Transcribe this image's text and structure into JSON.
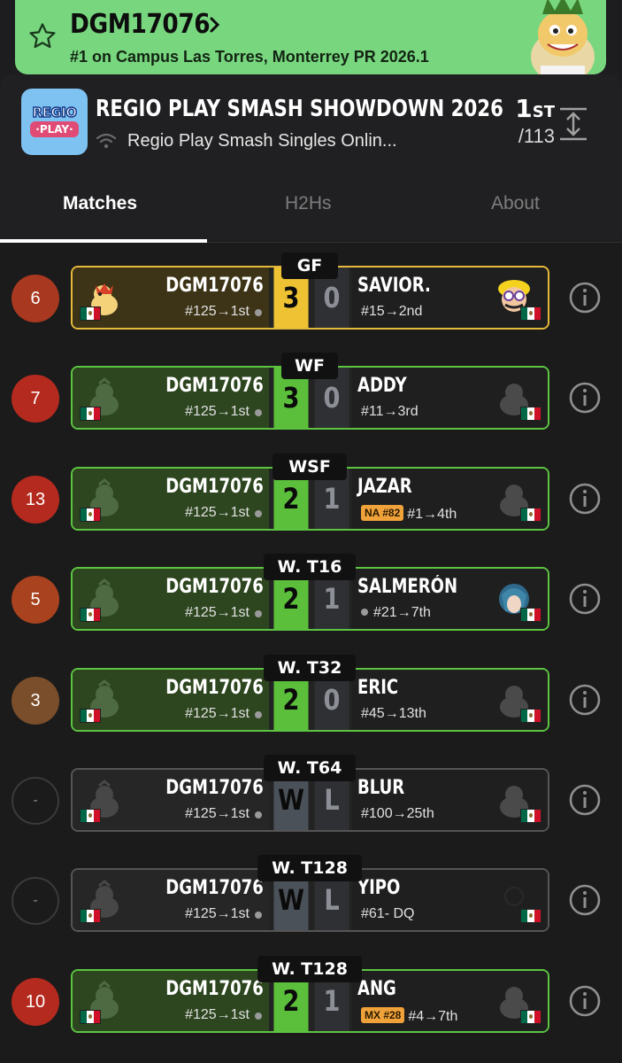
{
  "banner": {
    "player": "DGM17076",
    "subtitle": "#1 on Campus Las Torres, Monterrey PR 2026.1"
  },
  "tournament": {
    "logo_line1": "REGIO",
    "logo_line2": "·PLAY·",
    "title": "REGIO PLAY SMASH SHOWDOWN 2026",
    "event": "Regio Play Smash Singles Onlin...",
    "placement": "1",
    "placement_suffix": "ST",
    "entrants": "/113"
  },
  "tabs": [
    "Matches",
    "H2Hs",
    "About"
  ],
  "colors": {
    "banner_green": "#78d67f",
    "win_green": "#5bbf3b",
    "gold": "#eec232",
    "seed_red": "#b52a1e",
    "badge_orange": "#f0a23a"
  },
  "matches": [
    {
      "seed": "6",
      "round": "GF",
      "player": "DGM17076",
      "player_seed": "#125→1st",
      "score1": "3",
      "score2": "0",
      "opponent": "SAVIOR.",
      "badge": "",
      "opp_seed": "#15→2nd",
      "opp_dot": false,
      "style": "gold",
      "char_left": "bowser-icon",
      "char_right": "wario-icon"
    },
    {
      "seed": "7",
      "round": "WF",
      "player": "DGM17076",
      "player_seed": "#125→1st",
      "score1": "3",
      "score2": "0",
      "opponent": "ADDY",
      "badge": "",
      "opp_seed": "#11→3rd",
      "opp_dot": false,
      "style": "win",
      "char_left": "character-icon",
      "char_right": "character-icon"
    },
    {
      "seed": "13",
      "round": "WSF",
      "player": "DGM17076",
      "player_seed": "#125→1st",
      "score1": "2",
      "score2": "1",
      "opponent": "JAZAR",
      "badge": "NA #82",
      "opp_seed": "#1→4th",
      "opp_dot": false,
      "style": "win",
      "char_left": "character-icon",
      "char_right": "character-icon"
    },
    {
      "seed": "5",
      "round": "W. T16",
      "player": "DGM17076",
      "player_seed": "#125→1st",
      "score1": "2",
      "score2": "1",
      "opponent": "SALMERÓN",
      "badge": "",
      "opp_seed": "#21→7th",
      "opp_dot": true,
      "style": "win",
      "char_left": "character-icon",
      "char_right": "byleth-icon"
    },
    {
      "seed": "3",
      "round": "W. T32",
      "player": "DGM17076",
      "player_seed": "#125→1st",
      "score1": "2",
      "score2": "0",
      "opponent": "ERIC",
      "badge": "",
      "opp_seed": "#45→13th",
      "opp_dot": false,
      "style": "win",
      "char_left": "character-icon",
      "char_right": "character-icon"
    },
    {
      "seed": "-",
      "round": "W. T64",
      "player": "DGM17076",
      "player_seed": "#125→1st",
      "score1": "W",
      "score2": "L",
      "opponent": "BLUR",
      "badge": "",
      "opp_seed": "#100→25th",
      "opp_dot": false,
      "style": "plain",
      "char_left": "character-icon",
      "char_right": "character-icon"
    },
    {
      "seed": "-",
      "round": "W. T128",
      "player": "DGM17076",
      "player_seed": "#125→1st",
      "score1": "W",
      "score2": "L",
      "opponent": "YIPO",
      "badge": "",
      "opp_seed": "#61- DQ",
      "opp_dot": false,
      "style": "plain",
      "char_left": "character-icon",
      "char_right": "character-icon"
    },
    {
      "seed": "10",
      "round": "W. T128",
      "player": "DGM17076",
      "player_seed": "#125→1st",
      "score1": "2",
      "score2": "1",
      "opponent": "ANG",
      "badge": "MX #28",
      "opp_seed": "#4→7th",
      "opp_dot": false,
      "style": "win",
      "char_left": "character-icon",
      "char_right": "character-icon"
    }
  ]
}
